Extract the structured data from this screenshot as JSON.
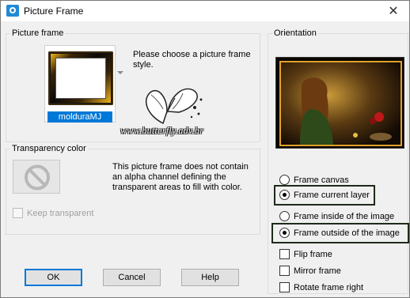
{
  "window": {
    "title": "Picture Frame",
    "close_glyph": "✕"
  },
  "picture_frame": {
    "group_label": "Picture frame",
    "selected_frame": "molduraMJ",
    "prompt": "Please choose a picture frame style."
  },
  "watermark": {
    "text": "www.butterfly.adv.br"
  },
  "transparency": {
    "group_label": "Transparency color",
    "info": "This picture frame does not contain an alpha channel defining the transparent areas to fill with color.",
    "keep_transparent_label": "Keep transparent",
    "keep_transparent_checked": false,
    "keep_transparent_enabled": false
  },
  "orientation": {
    "group_label": "Orientation",
    "options": [
      {
        "label": "Frame canvas",
        "type": "radio",
        "checked": false
      },
      {
        "label": "Frame current layer",
        "type": "radio",
        "checked": true
      },
      {
        "label": "Frame inside of the image",
        "type": "radio",
        "checked": false
      },
      {
        "label": "Frame outside of the image",
        "type": "radio",
        "checked": true
      },
      {
        "label": "Flip frame",
        "type": "checkbox",
        "checked": false
      },
      {
        "label": "Mirror frame",
        "type": "checkbox",
        "checked": false
      },
      {
        "label": "Rotate frame right",
        "type": "checkbox",
        "checked": false
      }
    ]
  },
  "buttons": {
    "ok": "OK",
    "cancel": "Cancel",
    "help": "Help"
  },
  "colors": {
    "accent": "#0078d7",
    "highlight_border": "#1e2a1a"
  },
  "icons": {
    "title": "camera-icon",
    "no_color": "no-symbol-icon"
  }
}
